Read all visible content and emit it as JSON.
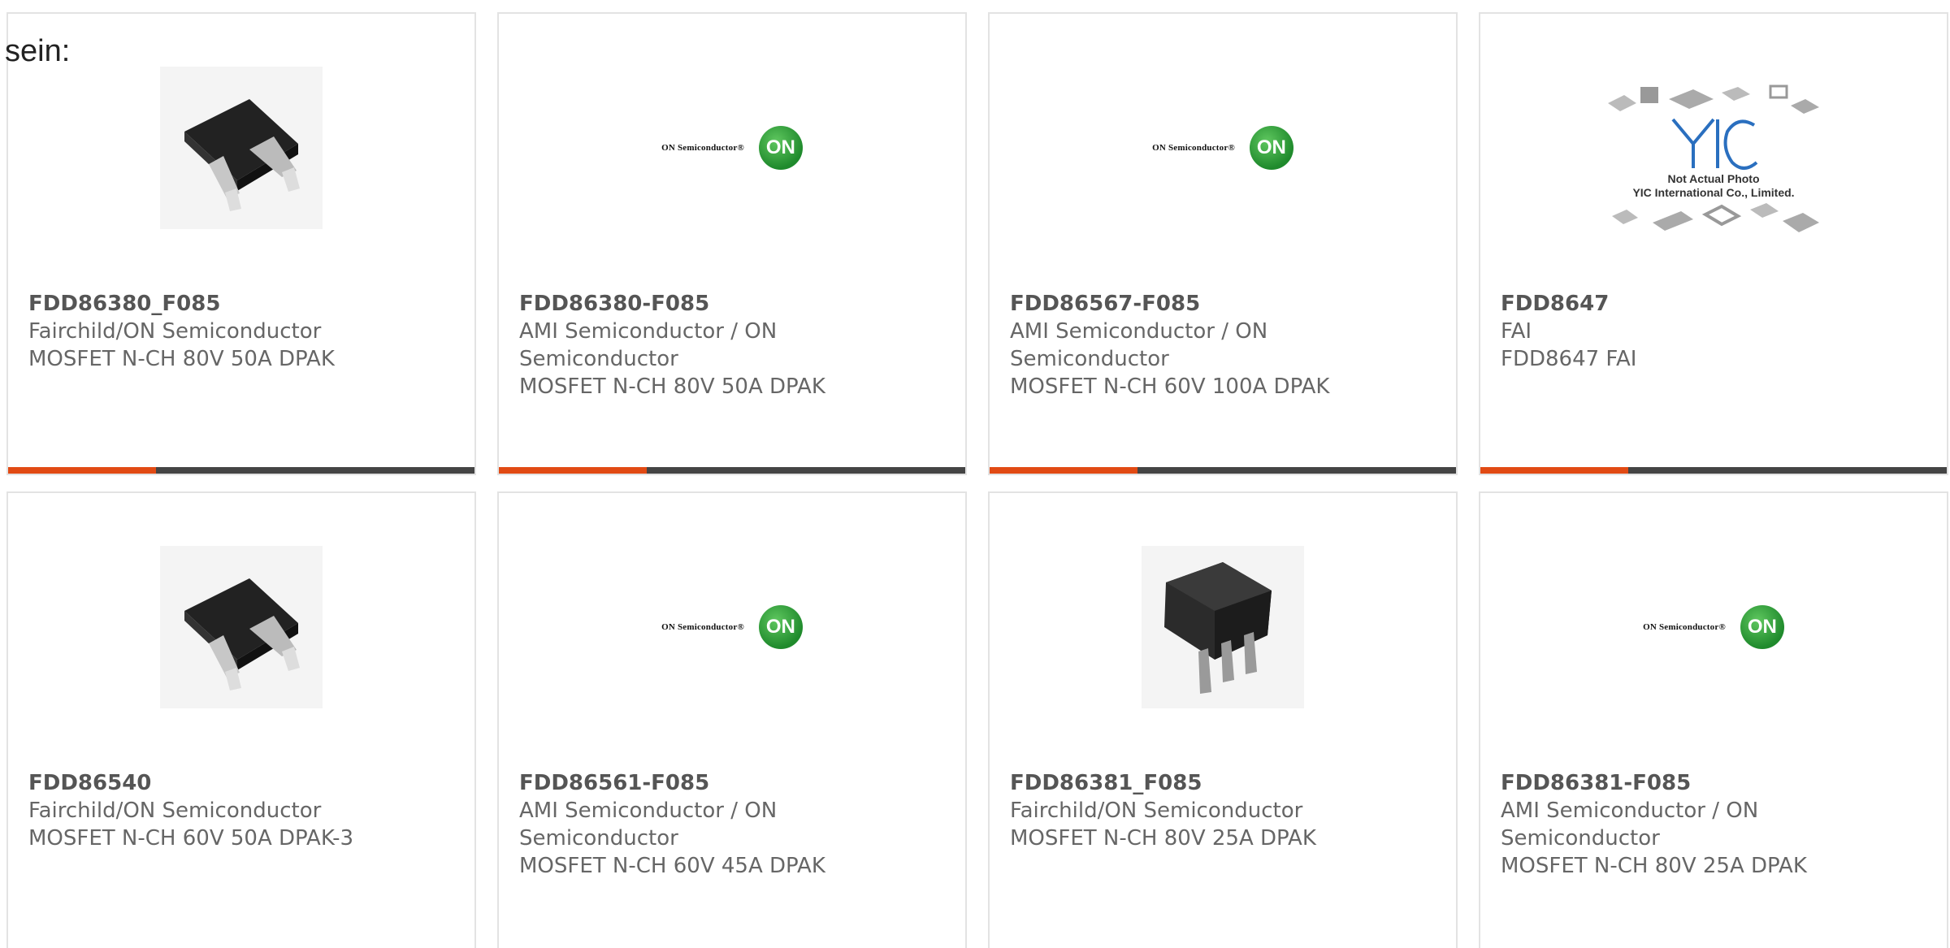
{
  "intro": {
    "text": "sein:"
  },
  "products": [
    {
      "part": "FDD86380_F085",
      "maker": "Fairchild/ON Semiconductor",
      "desc": "MOSFET N-CH 80V 50A DPAK",
      "image": "dpak-package-photo"
    },
    {
      "part": "FDD86380-F085",
      "maker": "AMI Semiconductor / ON Semiconductor",
      "desc": "MOSFET N-CH 80V 50A DPAK",
      "image": "on-semiconductor-logo",
      "logo_text": "ON Semiconductor®",
      "logo_mark": "ON"
    },
    {
      "part": "FDD86567-F085",
      "maker": "AMI Semiconductor / ON Semiconductor",
      "desc": "MOSFET N-CH 60V 100A DPAK",
      "image": "on-semiconductor-logo",
      "logo_text": "ON Semiconductor®",
      "logo_mark": "ON"
    },
    {
      "part": "FDD8647",
      "maker": "FAI",
      "desc": "FDD8647 FAI",
      "image": "yic-placeholder",
      "caption_line1": "Not Actual Photo",
      "caption_line2": "YIC International Co., Limited."
    },
    {
      "part": "FDD86540",
      "maker": "Fairchild/ON Semiconductor",
      "desc": "MOSFET N-CH 60V 50A DPAK-3",
      "image": "dpak-package-photo"
    },
    {
      "part": "FDD86561-F085",
      "maker": "AMI Semiconductor / ON Semiconductor",
      "desc": "MOSFET N-CH 60V 45A DPAK",
      "image": "on-semiconductor-logo",
      "logo_text": "ON Semiconductor®",
      "logo_mark": "ON"
    },
    {
      "part": "FDD86381_F085",
      "maker": "Fairchild/ON Semiconductor",
      "desc": "MOSFET N-CH 80V 25A DPAK",
      "image": "d2pak-package-photo"
    },
    {
      "part": "FDD86381-F085",
      "maker": "AMI Semiconductor / ON Semiconductor",
      "desc": "MOSFET N-CH 80V 25A DPAK",
      "image": "on-semiconductor-logo",
      "logo_text": "ON Semiconductor®",
      "logo_mark": "ON"
    }
  ],
  "colors": {
    "accent": "#e14a14",
    "bar": "#444444",
    "on_green": "#1f8a2c"
  }
}
